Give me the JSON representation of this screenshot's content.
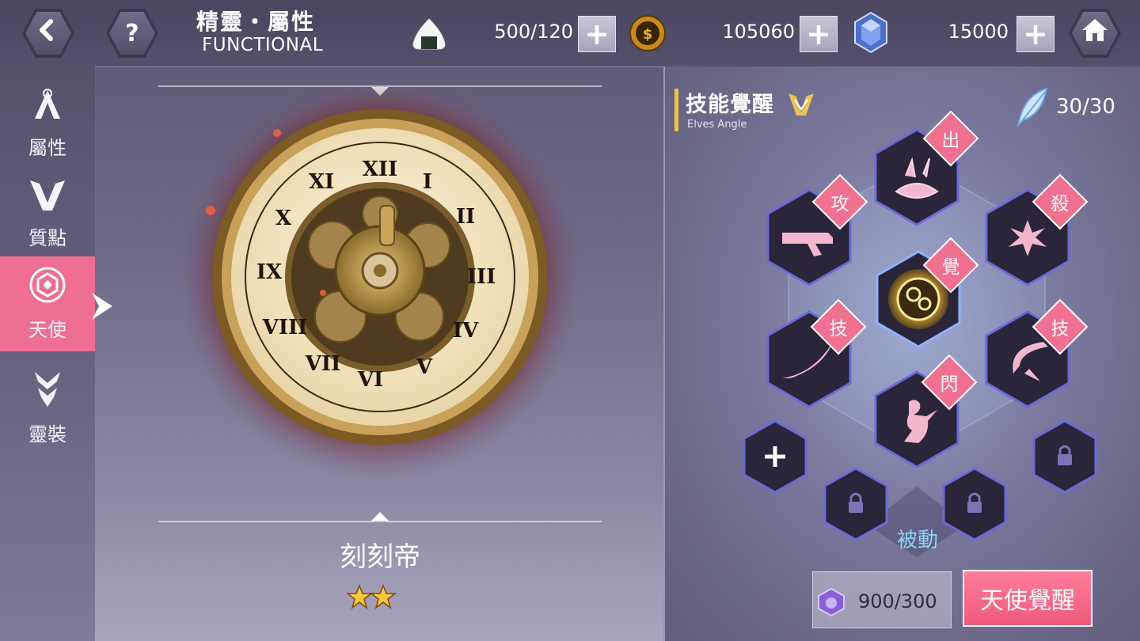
{
  "header": {
    "title_main": "精靈・屬性",
    "title_sub": "FUNCTIONAL",
    "stamina": "500/120",
    "gold": "105060",
    "crystal": "15000",
    "back_icon": "back-icon",
    "help_icon": "help-icon",
    "home_icon": "home-icon"
  },
  "sidebar": {
    "items": [
      {
        "label": "屬性",
        "icon": "attribute-icon"
      },
      {
        "label": "質點",
        "icon": "sephira-icon"
      },
      {
        "label": "天使",
        "icon": "angel-icon",
        "active": true
      },
      {
        "label": "靈裝",
        "icon": "astral-dress-icon"
      }
    ]
  },
  "character": {
    "name": "刻刻帝",
    "stars": 2
  },
  "skill_panel": {
    "title": "技能覺醒",
    "subtitle": "Elves Angle",
    "feather_count": "30/30",
    "skills": [
      {
        "tag": "出"
      },
      {
        "tag": "攻"
      },
      {
        "tag": "殺"
      },
      {
        "tag": "覺"
      },
      {
        "tag": "技"
      },
      {
        "tag": "技"
      },
      {
        "tag": "閃"
      }
    ],
    "passive_label": "被動",
    "cost": "900/300",
    "awaken_button": "天使覺醒"
  },
  "colors": {
    "accent_pink": "#ee6f8f",
    "title_bar_gold": "#f2c23c",
    "passive_blue": "#8ad3f5"
  }
}
